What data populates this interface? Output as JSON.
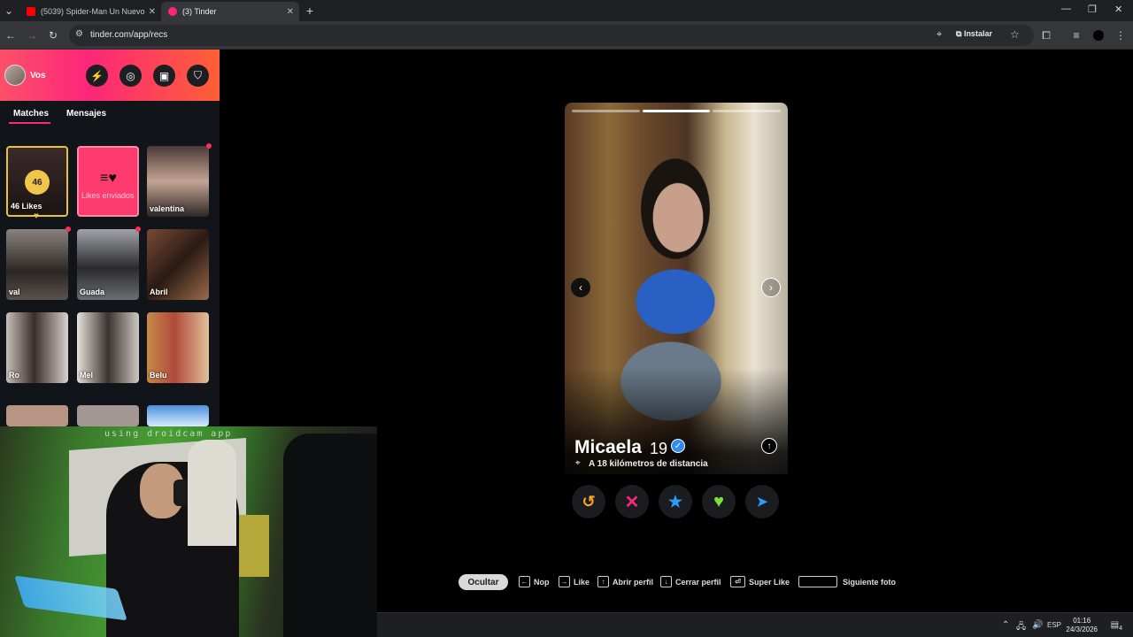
{
  "browser": {
    "tabs": [
      {
        "label": "(5039) Spider-Man Un Nuevo U",
        "favicon_color": "#ff0000"
      },
      {
        "label": "(3) Tinder",
        "favicon_color": "#fd267a"
      }
    ],
    "url": "tinder.com/app/recs",
    "install_label": "Instalar",
    "icons": {
      "back": "arrow-left-icon",
      "forward": "arrow-right-icon",
      "reload": "reload-icon",
      "new_tab": "plus-icon"
    }
  },
  "sidebar": {
    "user_name": "Vos",
    "tabs": [
      {
        "label": "Matches",
        "active": true
      },
      {
        "label": "Mensajes",
        "active": false
      }
    ],
    "likes_count": "46",
    "likes_label": "46 Likes",
    "likes_sent_label": "Likes enviados",
    "matches": [
      {
        "name": "valentina",
        "new": true
      },
      {
        "name": "val",
        "new": true
      },
      {
        "name": "Guada",
        "new": true
      },
      {
        "name": "Abril",
        "new": false
      },
      {
        "name": "Ro",
        "new": false
      },
      {
        "name": "Mel",
        "new": false
      },
      {
        "name": "Belu",
        "new": false
      }
    ],
    "accent": "#fd267a"
  },
  "profile": {
    "name": "Micaela",
    "age": "19",
    "distance": "A 18 kilómetros de distancia",
    "photos_total": 3,
    "photo_index": 2,
    "verified": true
  },
  "actions": {
    "rewind_color": "#f5a623",
    "nope_color": "#fd267a",
    "superlike_color": "#2e9bff",
    "like_color": "#7ee03a",
    "boost_color": "#2e9bff"
  },
  "shortcuts": {
    "hide": "Ocultar",
    "nope": "Nop",
    "like": "Like",
    "open_profile": "Abrir perfil",
    "close_profile": "Cerrar perfil",
    "super_like": "Super Like",
    "next_photo": "Siguiente foto"
  },
  "webcam": {
    "overlay_text": "using droidcam app"
  },
  "taskbar": {
    "lang": "ESP",
    "time": "01:16",
    "date": "24/3/2026",
    "notifications": "4"
  }
}
